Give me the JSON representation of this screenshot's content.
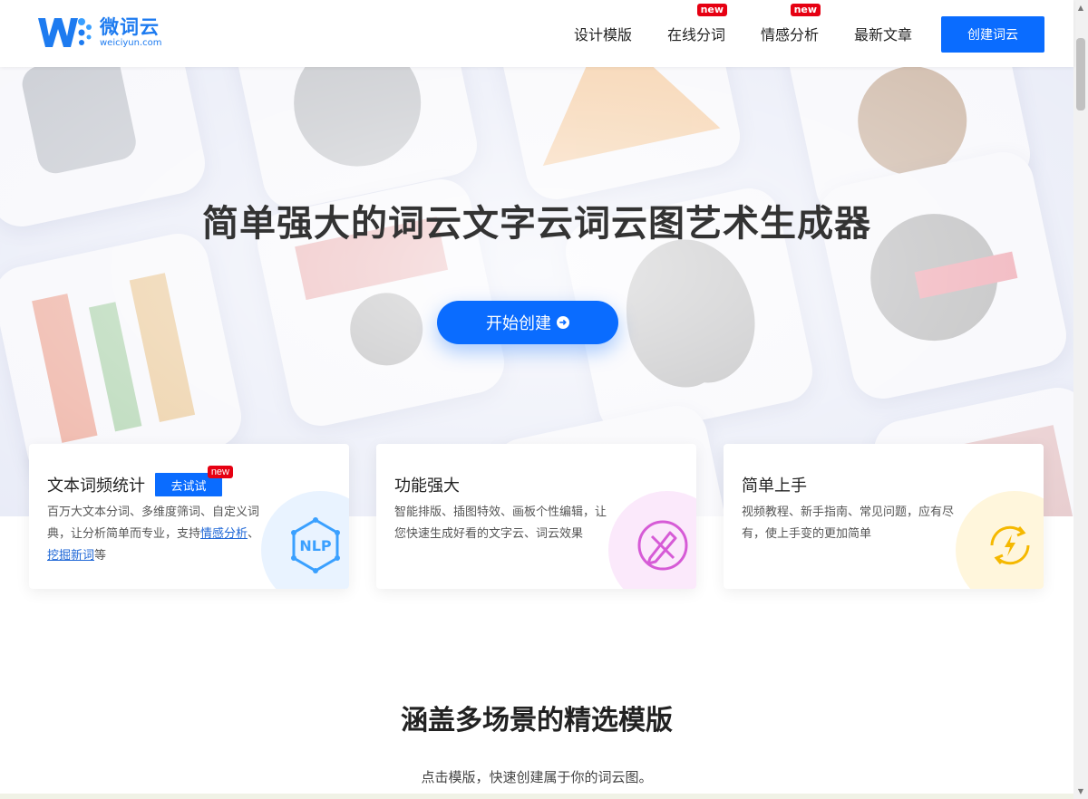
{
  "brand": {
    "name": "微词云",
    "domain": "weiciyun.com",
    "accent": "#0a6cff"
  },
  "nav": {
    "items": [
      {
        "label": "设计模版",
        "badge": ""
      },
      {
        "label": "在线分词",
        "badge": "new"
      },
      {
        "label": "情感分析",
        "badge": "new"
      },
      {
        "label": "最新文章",
        "badge": ""
      }
    ],
    "create_label": "创建词云"
  },
  "hero": {
    "title": "简单强大的词云文字云词云图艺术生成器",
    "cta_label": "开始创建",
    "cta_icon": "arrow-circle-right-icon"
  },
  "features": [
    {
      "title": "文本词频统计",
      "try_label": "去试试",
      "try_badge": "new",
      "desc_prefix": "百万大文本分词、多维度筛词、自定义词典，让分析简单而专业，支持",
      "link1": "情感分析",
      "sep": "、",
      "link2": "挖掘新词",
      "desc_suffix": "等",
      "icon": "nlp-icon",
      "color": "#3aa0ff"
    },
    {
      "title": "功能强大",
      "desc": "智能排版、插图特效、画板个性编辑，让您快速生成好看的文字云、词云效果",
      "icon": "design-tools-icon",
      "color": "#d65bd6"
    },
    {
      "title": "简单上手",
      "desc": "视频教程、新手指南、常见问题，应有尽有，使上手变的更加简单",
      "icon": "lightning-refresh-icon",
      "color": "#f5b800"
    }
  ],
  "templates_section": {
    "title": "涵盖多场景的精选模版",
    "subtitle": "点击模版，快速创建属于你的词云图。"
  }
}
